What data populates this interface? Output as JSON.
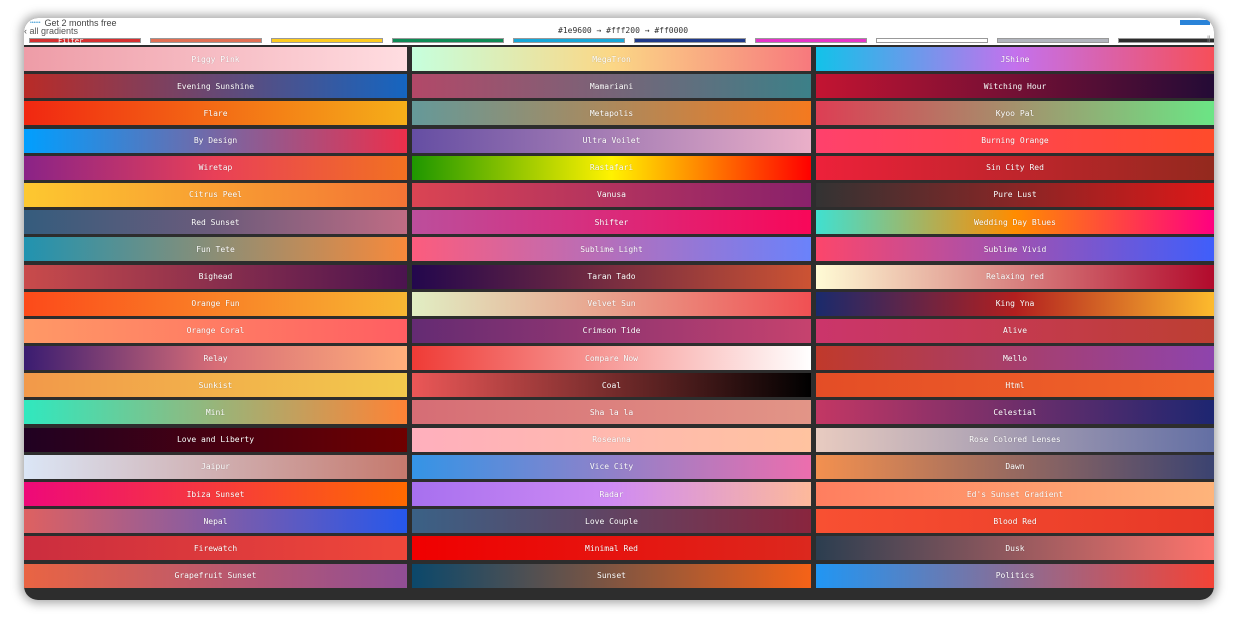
{
  "header": {
    "promo_text": "Get 2 months free",
    "promo_logo": "••••••",
    "back_link": "all gradients",
    "hex_line": "#1e9600 → #fff200 → #ff0000",
    "filter_label": "Filter",
    "scroll_grip": "‖"
  },
  "swatches": [
    "#d63031",
    "#e17055",
    "#fdcb20",
    "#0e8a55",
    "#17a7d8",
    "#1f3a8a",
    "#e536c8",
    "#ffffff",
    "#b2b5bd",
    "#2d2d2d"
  ],
  "gradients": [
    {
      "name": "Piggy Pink",
      "colors": [
        "#ee9ca7",
        "#ffdde1"
      ]
    },
    {
      "name": "MegaTron",
      "colors": [
        "#c6ffdd",
        "#fbd786",
        "#f7797d"
      ]
    },
    {
      "name": "JShine",
      "colors": [
        "#12c2e9",
        "#c471ed",
        "#f64f59"
      ]
    },
    {
      "name": "Evening Sunshine",
      "colors": [
        "#b92b27",
        "#1565c0"
      ]
    },
    {
      "name": "Mamariani",
      "colors": [
        "#b24868",
        "#3c8088"
      ]
    },
    {
      "name": "Witching Hour",
      "colors": [
        "#c31432",
        "#240b36"
      ]
    },
    {
      "name": "Flare",
      "colors": [
        "#f12711",
        "#f5af19"
      ]
    },
    {
      "name": "Metapolis",
      "colors": [
        "#659999",
        "#f4791f"
      ]
    },
    {
      "name": "Kyoo Pal",
      "colors": [
        "#dd3e54",
        "#6be585"
      ]
    },
    {
      "name": "By Design",
      "colors": [
        "#009fff",
        "#ec2f4b"
      ]
    },
    {
      "name": "Ultra Voilet",
      "colors": [
        "#654ea3",
        "#eaafc8"
      ]
    },
    {
      "name": "Burning Orange",
      "colors": [
        "#ff416c",
        "#ff4b2b"
      ]
    },
    {
      "name": "Wiretap",
      "colors": [
        "#8a2387",
        "#e94057",
        "#f27121"
      ]
    },
    {
      "name": "Rastafari",
      "colors": [
        "#1e9600",
        "#fff200",
        "#ff0000"
      ]
    },
    {
      "name": "Sin City Red",
      "colors": [
        "#ed213a",
        "#93291e"
      ]
    },
    {
      "name": "Citrus Peel",
      "colors": [
        "#fdc830",
        "#f37335"
      ]
    },
    {
      "name": "Vanusa",
      "colors": [
        "#da4453",
        "#89216b"
      ]
    },
    {
      "name": "Pure Lust",
      "colors": [
        "#333333",
        "#dd1818"
      ]
    },
    {
      "name": "Red Sunset",
      "colors": [
        "#355c7d",
        "#6c5b7b",
        "#c06c84"
      ]
    },
    {
      "name": "Shifter",
      "colors": [
        "#bc4e9c",
        "#f80759"
      ]
    },
    {
      "name": "Wedding Day Blues",
      "colors": [
        "#40e0d0",
        "#ff8c00",
        "#ff0080"
      ]
    },
    {
      "name": "Fun Tete",
      "colors": [
        "#2193b0",
        "#f7893b"
      ]
    },
    {
      "name": "Sublime Light",
      "colors": [
        "#fc5c7d",
        "#6a82fb"
      ]
    },
    {
      "name": "Sublime Vivid",
      "colors": [
        "#fc466b",
        "#3f5efb"
      ]
    },
    {
      "name": "Bighead",
      "colors": [
        "#c94b4b",
        "#4b134f"
      ]
    },
    {
      "name": "Taran Tado",
      "colors": [
        "#23074d",
        "#cc5333"
      ]
    },
    {
      "name": "Relaxing red",
      "colors": [
        "#fffbd5",
        "#b20a2c"
      ]
    },
    {
      "name": "Orange Fun",
      "colors": [
        "#fc4a1a",
        "#f7b733"
      ]
    },
    {
      "name": "Velvet Sun",
      "colors": [
        "#e1eec3",
        "#f05053"
      ]
    },
    {
      "name": "King Yna",
      "colors": [
        "#1a2a6c",
        "#b21f1f",
        "#fdbb2d"
      ]
    },
    {
      "name": "Orange Coral",
      "colors": [
        "#ff9966",
        "#ff5e62"
      ]
    },
    {
      "name": "Crimson Tide",
      "colors": [
        "#642b73",
        "#c6426e"
      ]
    },
    {
      "name": "Alive",
      "colors": [
        "#cb356b",
        "#bd3f32"
      ]
    },
    {
      "name": "Relay",
      "colors": [
        "#3a1c71",
        "#d76d77",
        "#ffaf7b"
      ]
    },
    {
      "name": "Compare Now",
      "colors": [
        "#ef3b36",
        "#ffffff"
      ]
    },
    {
      "name": "Mello",
      "colors": [
        "#c0392b",
        "#8e44ad"
      ]
    },
    {
      "name": "Sunkist",
      "colors": [
        "#f2994a",
        "#f2c94c"
      ]
    },
    {
      "name": "Coal",
      "colors": [
        "#eb5757",
        "#000000"
      ]
    },
    {
      "name": "Html",
      "colors": [
        "#e44d26",
        "#f16529"
      ]
    },
    {
      "name": "Mini",
      "colors": [
        "#30e8bf",
        "#ff8235"
      ]
    },
    {
      "name": "Sha la la",
      "colors": [
        "#d66d75",
        "#e29587"
      ]
    },
    {
      "name": "Celestial",
      "colors": [
        "#c33764",
        "#1d2671"
      ]
    },
    {
      "name": "Love and Liberty",
      "colors": [
        "#200122",
        "#6f0000"
      ]
    },
    {
      "name": "Roseanna",
      "colors": [
        "#ffafbd",
        "#ffc3a0"
      ]
    },
    {
      "name": "Rose Colored Lenses",
      "colors": [
        "#e8cbc0",
        "#636fa4"
      ]
    },
    {
      "name": "Jaipur",
      "colors": [
        "#dbe6f6",
        "#c5796d"
      ]
    },
    {
      "name": "Vice City",
      "colors": [
        "#3494e6",
        "#ec6ead"
      ]
    },
    {
      "name": "Dawn",
      "colors": [
        "#f3904f",
        "#3b4371"
      ]
    },
    {
      "name": "Ibiza Sunset",
      "colors": [
        "#ee0979",
        "#ff6a00"
      ]
    },
    {
      "name": "Radar",
      "colors": [
        "#a770ef",
        "#cf8bf3",
        "#fdb99b"
      ]
    },
    {
      "name": "Ed's Sunset Gradient",
      "colors": [
        "#ff7e5f",
        "#feb47b"
      ]
    },
    {
      "name": "Nepal",
      "colors": [
        "#de6161",
        "#2657eb"
      ]
    },
    {
      "name": "Love Couple",
      "colors": [
        "#3a6186",
        "#89253e"
      ]
    },
    {
      "name": "Blood Red",
      "colors": [
        "#f85032",
        "#e73827"
      ]
    },
    {
      "name": "Firewatch",
      "colors": [
        "#cb2d3e",
        "#ef473a"
      ]
    },
    {
      "name": "Minimal Red",
      "colors": [
        "#f00000",
        "#dc281e"
      ]
    },
    {
      "name": "Dusk",
      "colors": [
        "#2c3e50",
        "#fd746c"
      ]
    },
    {
      "name": "Grapefruit Sunset",
      "colors": [
        "#e96443",
        "#904e95"
      ]
    },
    {
      "name": "Sunset",
      "colors": [
        "#0b486b",
        "#f56217"
      ]
    },
    {
      "name": "Politics",
      "colors": [
        "#2196f3",
        "#f44336"
      ]
    }
  ]
}
